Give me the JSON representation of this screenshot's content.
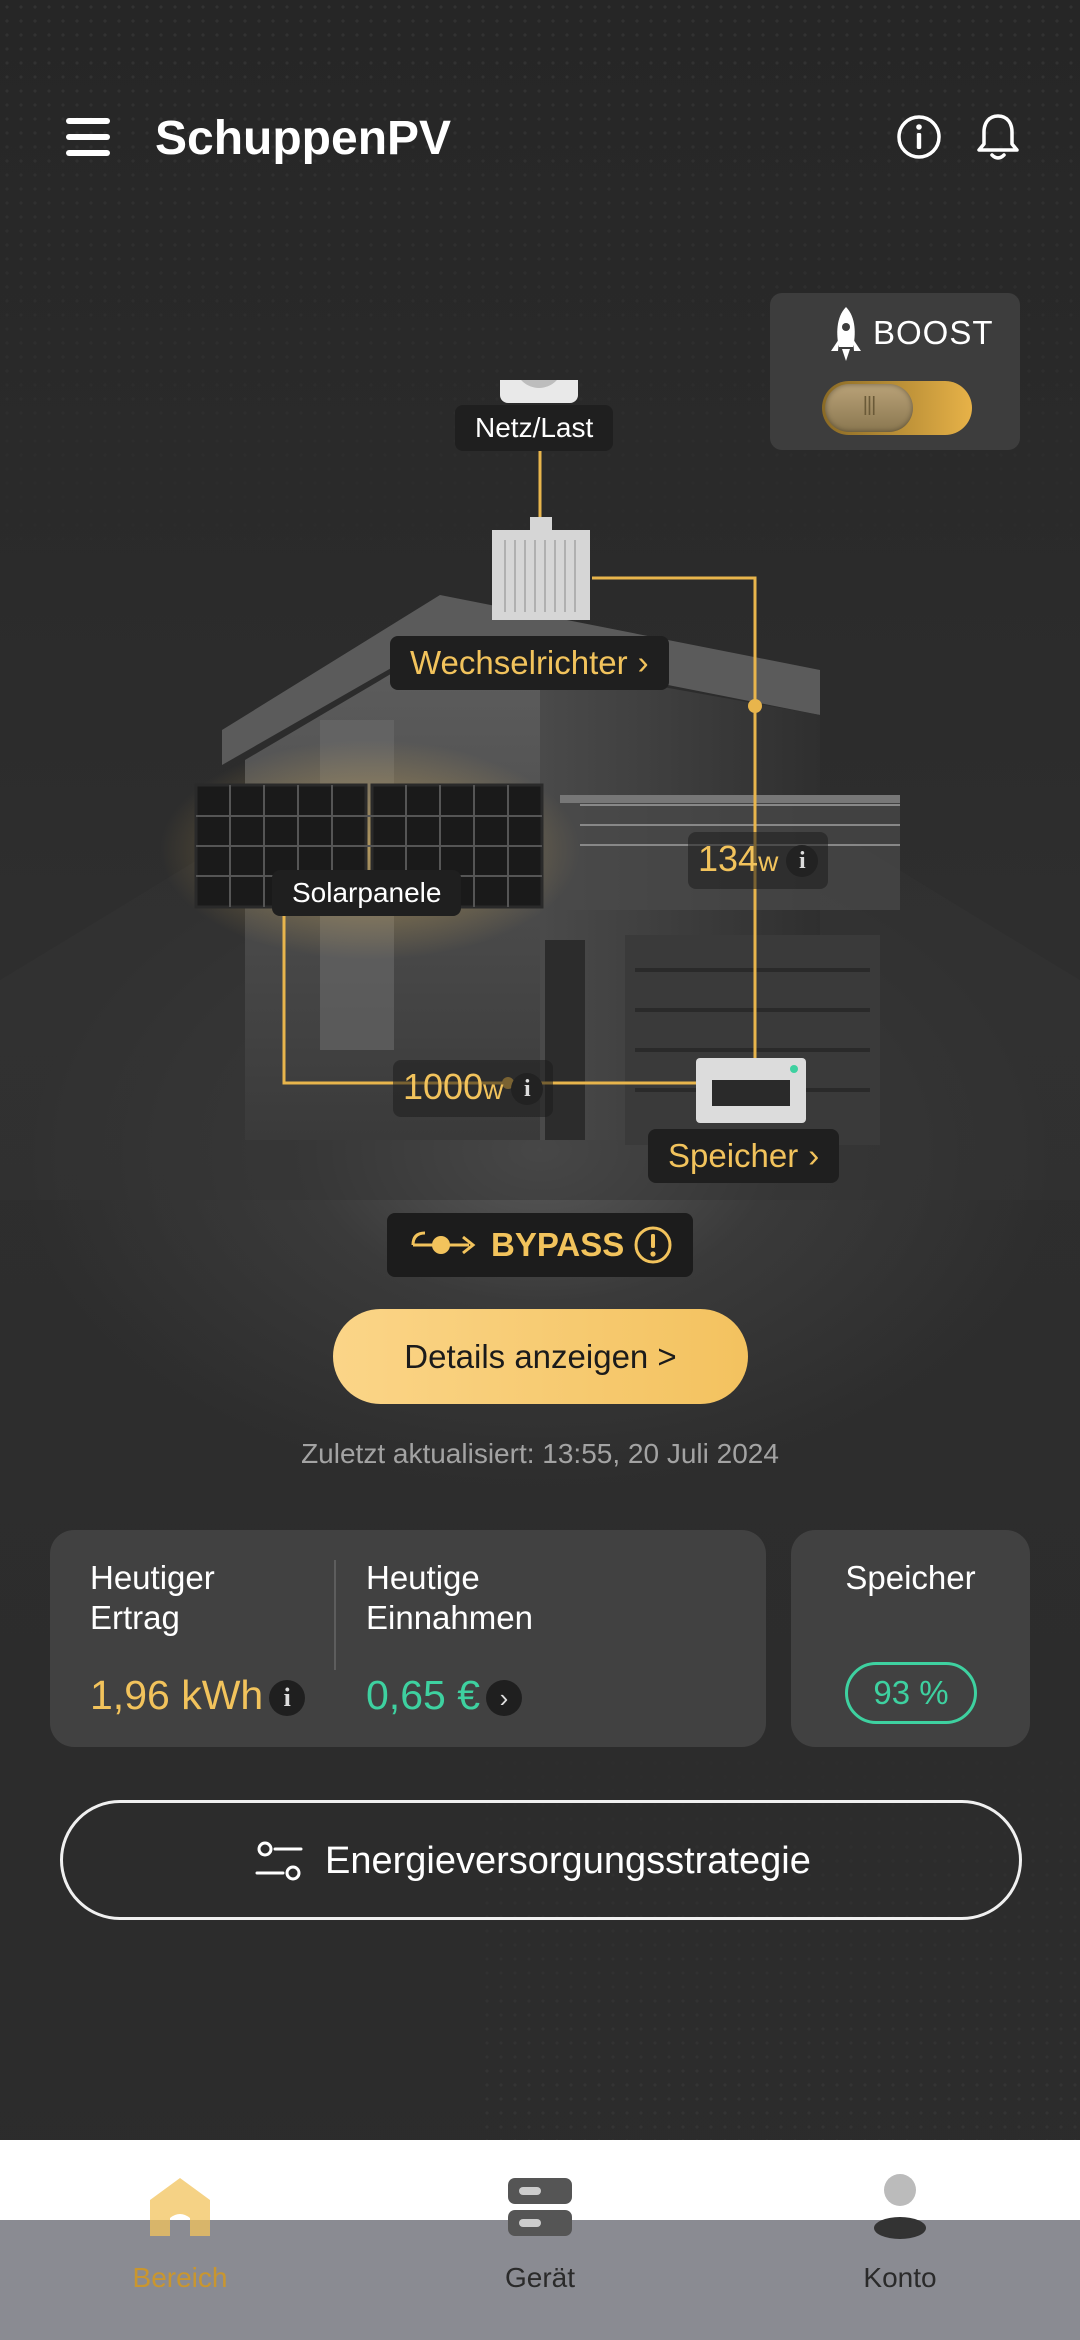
{
  "header": {
    "title": "SchuppenPV"
  },
  "boost": {
    "label": "BOOST",
    "enabled": true
  },
  "diagram": {
    "grid_label": "Netz/Last",
    "inverter_label": "Wechselrichter",
    "solar_label": "Solarpanele",
    "storage_label": "Speicher",
    "power_inverter_value": "134",
    "power_inverter_unit": "w",
    "power_solar_value": "1000",
    "power_solar_unit": "w",
    "info_glyph": "i",
    "chevron": "›"
  },
  "bypass": {
    "label": "BYPASS"
  },
  "details_button": "Details anzeigen >",
  "updated": "Zuletzt aktualisiert: 13:55, 20 Juli 2024",
  "stats": {
    "yield_label": "Heutiger Ertrag",
    "yield_value": "1,96 kWh",
    "income_label": "Heutige Einnahmen",
    "income_value": "0,65 €",
    "storage_label": "Speicher",
    "storage_value": "93 %"
  },
  "strategy_button": "Energieversorgungsstrategie",
  "nav": [
    {
      "label": "Bereich",
      "icon": "home-icon",
      "active": true
    },
    {
      "label": "Gerät",
      "icon": "device-icon",
      "active": false
    },
    {
      "label": "Konto",
      "icon": "account-icon",
      "active": false
    }
  ],
  "colors": {
    "accent": "#f2c35c",
    "green": "#3ed1a0",
    "background": "#2b2b2b",
    "card": "#414141"
  }
}
